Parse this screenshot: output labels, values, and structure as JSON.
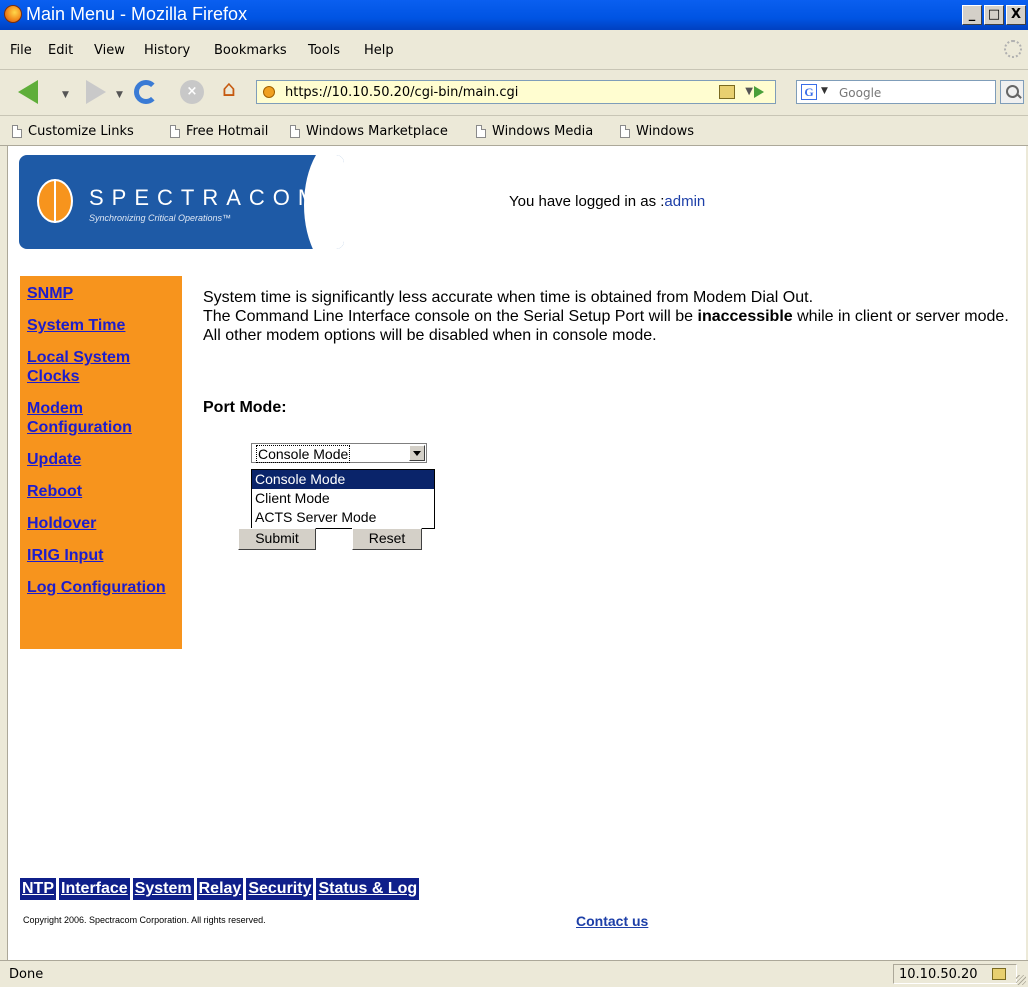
{
  "window": {
    "title": "Main Menu - Mozilla Firefox",
    "btn_min": "_",
    "btn_max": "□",
    "btn_close": "X"
  },
  "menubar": {
    "items": [
      "File",
      "Edit",
      "View",
      "History",
      "Bookmarks",
      "Tools",
      "Help"
    ]
  },
  "navbar": {
    "url": "https://10.10.50.20/cgi-bin/main.cgi",
    "search_placeholder": "Google",
    "google_letter": "G"
  },
  "bookmarks": [
    "Customize Links",
    "Free Hotmail",
    "Windows Marketplace",
    "Windows Media",
    "Windows"
  ],
  "logo": {
    "name": "SPECTRACOM",
    "tagline": "Synchronizing Critical Operations™"
  },
  "login": {
    "prefix": "You have logged in as :",
    "user": "admin"
  },
  "sidebar": {
    "links": [
      "SNMP",
      "System Time",
      "Local System Clocks",
      "Modem Configuration",
      "Update",
      "Reboot",
      "Holdover",
      "IRIG Input",
      "Log Configuration"
    ]
  },
  "main": {
    "line1": "System time is significantly less accurate when time is obtained from Modem Dial Out.",
    "line2_pre": "The Command Line Interface console on the Serial Setup Port will be ",
    "line2_bold": "inaccessible",
    "line2_post": " while in client or server mode.",
    "line3": "All other modem options will be disabled when in console mode.",
    "port_label": "Port Mode:"
  },
  "port_select": {
    "selected": "Console Mode",
    "options": [
      "Console Mode",
      "Client Mode",
      "ACTS Server Mode"
    ]
  },
  "buttons": {
    "submit": "Submit",
    "reset": "Reset"
  },
  "bottom_nav": [
    "NTP",
    "Interface",
    "System",
    "Relay",
    "Security",
    "Status & Log"
  ],
  "footer": {
    "copyright": "Copyright 2006. Spectracom Corporation. All rights reserved.",
    "contact": "Contact us"
  },
  "statusbar": {
    "text": "Done",
    "host": "10.10.50.20"
  },
  "colors": {
    "sidebar": "#f7941d",
    "link": "#1d1dcc",
    "bottom_nav_bg": "#0f1f8a",
    "logo_blue": "#1e5aa6",
    "selected_option": "#0a246a"
  },
  "icons": [
    "firefox-icon",
    "back-icon",
    "forward-icon",
    "reload-icon",
    "stop-icon",
    "home-icon",
    "site-identity-icon",
    "padlock-icon",
    "go-icon",
    "search-icon",
    "throbber-icon",
    "page-icon"
  ]
}
